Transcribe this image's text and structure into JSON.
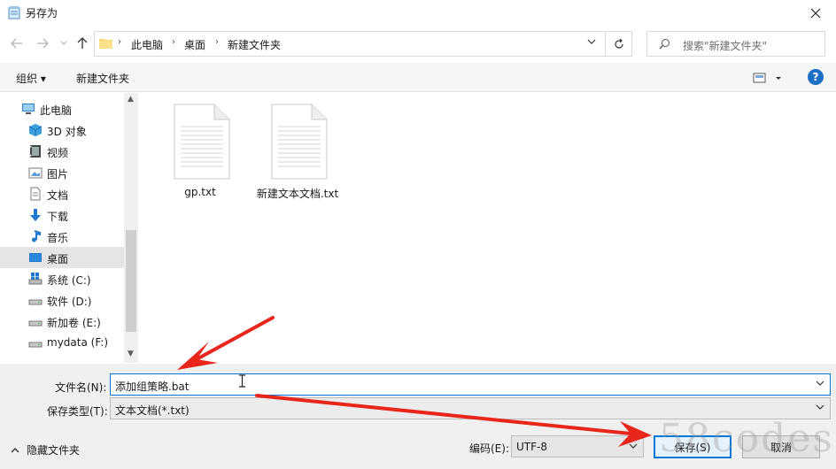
{
  "window": {
    "title": "另存为",
    "close_icon": "close-icon"
  },
  "nav": {
    "breadcrumbs": [
      "此电脑",
      "桌面",
      "新建文件夹"
    ],
    "search_placeholder": "搜索\"新建文件夹\""
  },
  "toolbar": {
    "organize_label": "组织 ▾",
    "new_folder_label": "新建文件夹",
    "help_label": "?"
  },
  "sidebar": {
    "items": [
      {
        "label": "此电脑",
        "icon": "computer-icon"
      },
      {
        "label": "3D 对象",
        "icon": "3d-objects-icon"
      },
      {
        "label": "视频",
        "icon": "video-icon"
      },
      {
        "label": "图片",
        "icon": "pictures-icon"
      },
      {
        "label": "文档",
        "icon": "documents-icon"
      },
      {
        "label": "下载",
        "icon": "download-icon"
      },
      {
        "label": "音乐",
        "icon": "music-icon"
      },
      {
        "label": "桌面",
        "icon": "desktop-icon",
        "selected": true
      },
      {
        "label": "系统 (C:)",
        "icon": "system-drive-icon"
      },
      {
        "label": "软件 (D:)",
        "icon": "drive-icon"
      },
      {
        "label": "新加卷 (E:)",
        "icon": "drive-icon"
      },
      {
        "label": "mydata (F:)",
        "icon": "drive-icon"
      }
    ]
  },
  "files": [
    {
      "name": "gp.txt",
      "icon": "text-file-icon"
    },
    {
      "name": "新建文本文档.txt",
      "icon": "text-file-icon"
    }
  ],
  "form": {
    "filename_label": "文件名(N):",
    "filename_value": "添加组策略.bat",
    "filetype_label": "保存类型(T):",
    "filetype_value": "文本文档(*.txt)",
    "hide_folders_label": "隐藏文件夹",
    "encoding_label": "编码(E):",
    "encoding_value": "UTF-8",
    "save_label": "保存(S)",
    "cancel_label": "取消"
  },
  "watermark": "58codes",
  "colors": {
    "accent": "#0078d7",
    "annotation_arrow": "#e8261b",
    "selected_bg": "#e5e5e5"
  }
}
